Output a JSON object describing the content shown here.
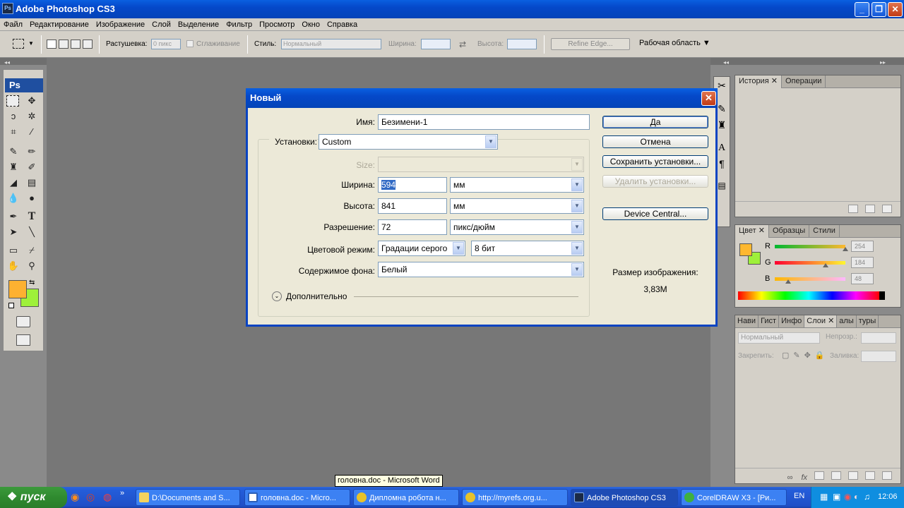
{
  "window": {
    "title": "Adobe Photoshop CS3",
    "app_icon": "Ps"
  },
  "menu": [
    "Файл",
    "Редактирование",
    "Изображение",
    "Слой",
    "Выделение",
    "Фильтр",
    "Просмотр",
    "Окно",
    "Справка"
  ],
  "options_bar": {
    "feather_label": "Растушевка:",
    "feather_value": "0 пикс",
    "antialias_label": "Сглаживание",
    "style_label": "Стиль:",
    "style_value": "Нормальный",
    "width_label": "Ширина:",
    "height_label": "Высота:",
    "refine_edge": "Refine Edge...",
    "workspace": "Рабочая область"
  },
  "toolbox": {
    "badge": "Ps",
    "fg_color": "#fdb131",
    "bg_color": "#9ef03a"
  },
  "dialog": {
    "title": "Новый",
    "name_label": "Имя:",
    "name_value": "Безимени-1",
    "preset_label": "Установки:",
    "preset_value": "Custom",
    "size_label": "Size:",
    "width_label": "Ширина:",
    "width_value": "594",
    "width_unit": "мм",
    "height_label": "Высота:",
    "height_value": "841",
    "height_unit": "мм",
    "resolution_label": "Разрешение:",
    "resolution_value": "72",
    "resolution_unit": "пикс/дюйм",
    "color_mode_label": "Цветовой режим:",
    "color_mode_value": "Градации серого",
    "bit_depth": "8 бит",
    "bg_contents_label": "Содержимое фона:",
    "bg_contents_value": "Белый",
    "advanced": "Дополнительно",
    "ok": "Да",
    "cancel": "Отмена",
    "save_preset": "Сохранить установки...",
    "delete_preset": "Удалить установки...",
    "device_central": "Device Central...",
    "image_size_label": "Размер изображения:",
    "image_size_value": "3,83М"
  },
  "panels": {
    "history_tabs": [
      "История",
      "Операции"
    ],
    "color_tabs": [
      "Цвет",
      "Образцы",
      "Стили"
    ],
    "color": {
      "r": "254",
      "g": "184",
      "b": "48",
      "r_frac": 1.0,
      "g_frac": 0.72,
      "b_frac": 0.19,
      "fg": "#feb830",
      "bg": "#9ef03a"
    },
    "color_channels": [
      "R",
      "G",
      "B"
    ],
    "layers_tabs": [
      "Нави",
      "Гист",
      "Инфо",
      "Слои",
      "алы",
      "туры"
    ],
    "layers_mode": "Нормальный",
    "opacity_label": "Непрозр.:",
    "lock_label": "Закрепить:",
    "fill_label": "Заливка:"
  },
  "taskbar": {
    "start": "пуск",
    "tasks": [
      "D:\\Documents and S...",
      "головна.doc - Micro...",
      "Дипломна робота н...",
      "http://myrefs.org.u...",
      "Adobe Photoshop CS3",
      "CorelDRAW X3 - [Ри..."
    ],
    "lang": "EN",
    "clock": "12:06",
    "tooltip": "головна.doc - Microsoft Word"
  }
}
